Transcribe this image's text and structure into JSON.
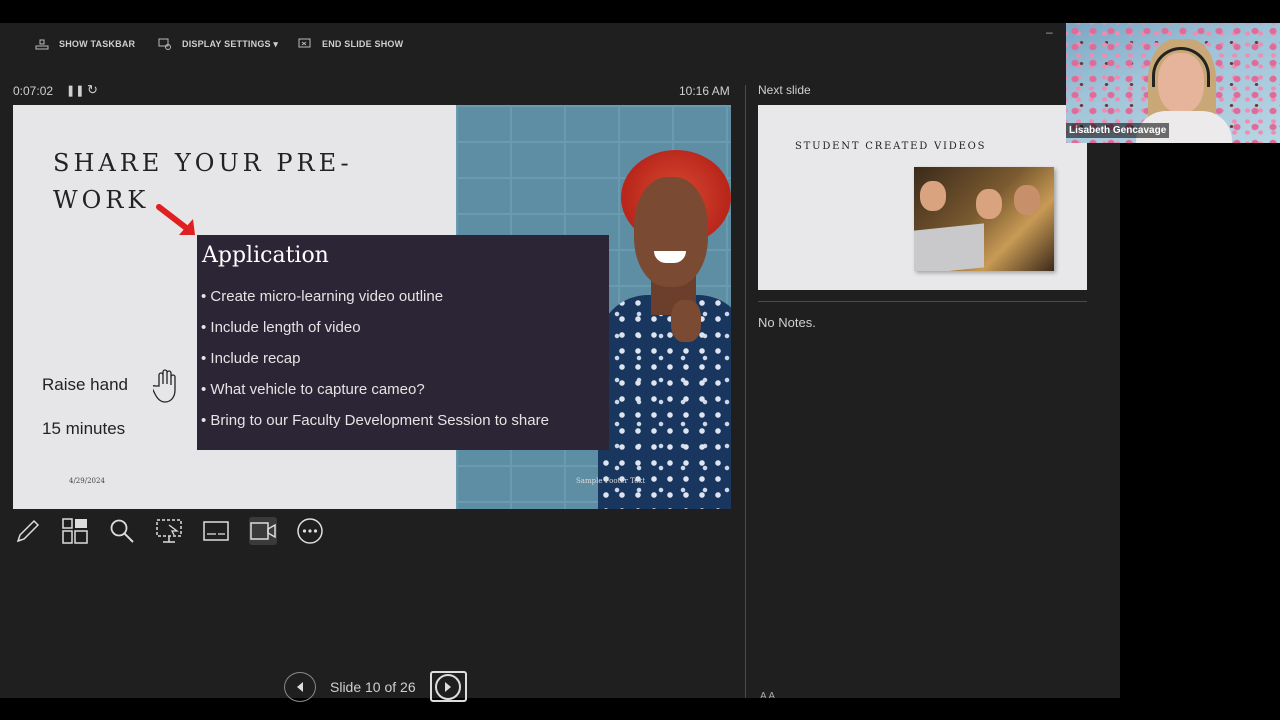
{
  "toolbar": {
    "show_taskbar": "SHOW TASKBAR",
    "display_settings": "DISPLAY SETTINGS ▾",
    "end_slide_show": "END SLIDE SHOW",
    "minimize": "–"
  },
  "status": {
    "timer": "0:07:02",
    "clock": "10:16 AM"
  },
  "current_slide": {
    "title": "SHARE YOUR PRE-WORK",
    "raise_hand": "Raise hand",
    "minutes": "15 minutes",
    "date": "4/29/2024",
    "footer": "Sample Footer Text",
    "application": {
      "heading": "Application",
      "items": [
        "Create micro-learning video outline",
        "Include length of video",
        "Include recap",
        "What vehicle to capture cameo?",
        "Bring to our Faculty Development Session to share"
      ]
    }
  },
  "tools": [
    "pen-icon",
    "slides-grid-icon",
    "zoom-icon",
    "pointer-screen-icon",
    "subtitles-icon",
    "camera-icon",
    "more-options-icon"
  ],
  "navigation": {
    "slide_count": "Slide 10 of 26"
  },
  "next_slide": {
    "label": "Next slide",
    "title": "STUDENT CREATED VIDEOS"
  },
  "notes": {
    "text": "No Notes."
  },
  "webcam": {
    "name": "Lisabeth Gencavage"
  },
  "colors": {
    "background": "#1f1f1f",
    "application_box": "#2b2535",
    "arrow": "#e02020"
  }
}
